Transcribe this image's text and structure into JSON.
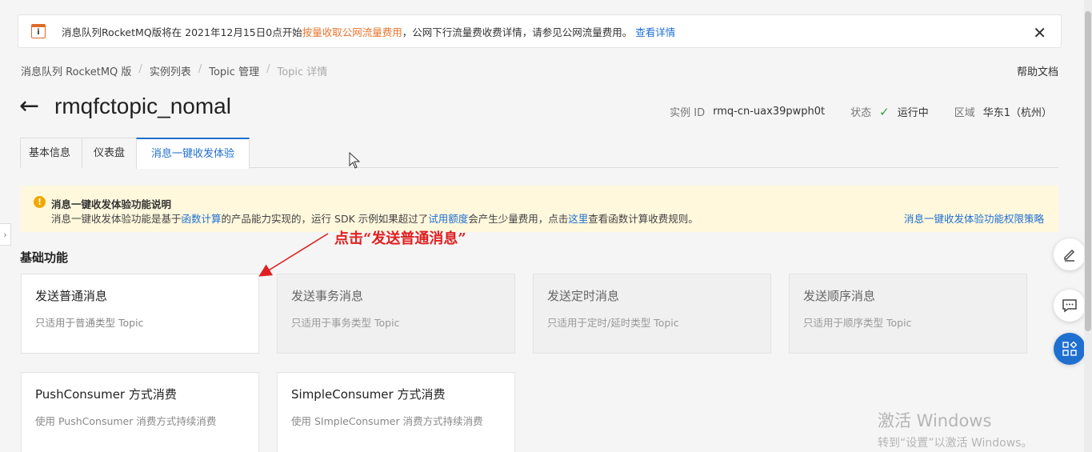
{
  "notice": {
    "icon": "info-icon",
    "text_before": "消息队列RocketMQ版将在 2021年12月15日0点开始",
    "text_highlight": "按量收取公网流量费用",
    "text_after": "，公网下行流量费收费详情，请参见公网流量费用。",
    "link": "查看详情",
    "close": "✕"
  },
  "breadcrumb": {
    "items": [
      "消息队列 RocketMQ 版",
      "实例列表",
      "Topic 管理"
    ],
    "current": "Topic 详情",
    "separator": "/"
  },
  "help_link": "帮助文档",
  "header": {
    "back_icon": "arrow-left-icon",
    "back_glyph": "←",
    "title": "rmqfctopic_nomal",
    "instance_label": "实例 ID",
    "instance_value": "rmq-cn-uax39pwph0t",
    "status_label": "状态",
    "status_value": "运行中",
    "status_glyph": "✓",
    "region_label": "区域",
    "region_value": "华东1（杭州）"
  },
  "tabs": [
    "基本信息",
    "仪表盘",
    "消息一键收发体验"
  ],
  "active_tab": 2,
  "tip": {
    "icon": "warning-icon",
    "title": "消息一键收发体验功能说明",
    "body_1": "消息一键收发体验功能是基于",
    "link_1": "函数计算",
    "body_2": "的产品能力实现的，运行 SDK 示例如果超过了",
    "link_2": "试用额度",
    "body_3": "会产生少量费用，点击",
    "link_3": "这里",
    "body_4": "查看函数计算收费规则。",
    "right_link": "消息一键收发体验功能权限策略"
  },
  "annotation": "点击“发送普通消息”",
  "section_title": "基础功能",
  "cards": [
    {
      "title": "发送普通消息",
      "desc": "只适用于普通类型 Topic"
    },
    {
      "title": "发送事务消息",
      "desc": "只适用于事务类型 Topic"
    },
    {
      "title": "发送定时消息",
      "desc": "只适用于定时/延时类型 Topic"
    },
    {
      "title": "发送顺序消息",
      "desc": "只适用于顺序类型 Topic"
    },
    {
      "title": "PushConsumer 方式消费",
      "desc": "使用 PushConsumer 消费方式持续消费"
    },
    {
      "title": "SimpleConsumer 方式消费",
      "desc": "使用 SImpleConsumer 消费方式持续消费"
    }
  ],
  "side_tab_glyph": "›",
  "float_buttons": [
    "edit-icon",
    "chat-icon",
    "apps-icon"
  ],
  "watermark": {
    "line1": "激活 Windows",
    "line2": "转到“设置”以激活 Windows。"
  },
  "colors": {
    "accent": "#1f6fd1",
    "highlight": "#e8752e",
    "annotation": "#e02020",
    "success": "#2aa04a",
    "tip_bg": "#fff8dd"
  }
}
